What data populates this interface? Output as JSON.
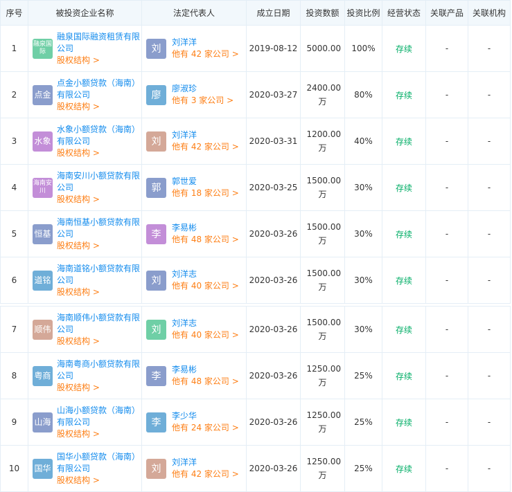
{
  "headers": [
    "序号",
    "被投资企业名称",
    "法定代表人",
    "成立日期",
    "投资数额",
    "投资比例",
    "经营状态",
    "关联产品",
    "关联机构"
  ],
  "equity_label": "股权结构 >",
  "rows": [
    {
      "no": "1",
      "logo": "融泉国际",
      "logo_color": "#6fcfa6",
      "company": "融泉国际融资租赁有限公司",
      "avatar": "刘",
      "avatar_color": "#8a9dcc",
      "rep": "刘洋洋",
      "rep_count": "他有 42 家公司 >",
      "date": "2019-08-12",
      "amount": "5000.00",
      "ratio": "100%",
      "status": "存续",
      "products": "-",
      "orgs": "-"
    },
    {
      "no": "2",
      "logo": "点金",
      "logo_color": "#8a9dcc",
      "company": "点金小额贷款（海南）有限公司",
      "avatar": "廖",
      "avatar_color": "#6faed8",
      "rep": "廖淑珍",
      "rep_count": "他有 3 家公司 >",
      "date": "2020-03-27",
      "amount": "2400.00万",
      "ratio": "80%",
      "status": "存续",
      "products": "-",
      "orgs": "-"
    },
    {
      "no": "3",
      "logo": "水象",
      "logo_color": "#c38ed8",
      "company": "水象小额贷款（海南）有限公司",
      "avatar": "刘",
      "avatar_color": "#d4a898",
      "rep": "刘洋洋",
      "rep_count": "他有 42 家公司 >",
      "date": "2020-03-31",
      "amount": "1200.00万",
      "ratio": "40%",
      "status": "存续",
      "products": "-",
      "orgs": "-"
    },
    {
      "no": "4",
      "logo": "海南安川",
      "logo_color": "#c38ed8",
      "company": "海南安川小额贷款有限公司",
      "avatar": "郭",
      "avatar_color": "#8a9dcc",
      "rep": "郭世爱",
      "rep_count": "他有 18 家公司 >",
      "date": "2020-03-25",
      "amount": "1500.00万",
      "ratio": "30%",
      "status": "存续",
      "products": "-",
      "orgs": "-"
    },
    {
      "no": "5",
      "logo": "恒基",
      "logo_color": "#8a9dcc",
      "company": "海南恒基小额贷款有限公司",
      "avatar": "李",
      "avatar_color": "#c38ed8",
      "rep": "李易彬",
      "rep_count": "他有 48 家公司 >",
      "date": "2020-03-26",
      "amount": "1500.00万",
      "ratio": "30%",
      "status": "存续",
      "products": "-",
      "orgs": "-"
    },
    {
      "no": "6",
      "logo": "道铭",
      "logo_color": "#6faed8",
      "company": "海南道铭小额贷款有限公司",
      "avatar": "刘",
      "avatar_color": "#8a9dcc",
      "rep": "刘洋志",
      "rep_count": "他有 40 家公司 >",
      "date": "2020-03-26",
      "amount": "1500.00万",
      "ratio": "30%",
      "status": "存续",
      "products": "-",
      "orgs": "-"
    },
    {
      "no": "7",
      "logo": "顺伟",
      "logo_color": "#d4a898",
      "company": "海南顺伟小额贷款有限公司",
      "avatar": "刘",
      "avatar_color": "#6fcfa6",
      "rep": "刘洋志",
      "rep_count": "他有 40 家公司 >",
      "date": "2020-03-26",
      "amount": "1500.00万",
      "ratio": "30%",
      "status": "存续",
      "products": "-",
      "orgs": "-"
    },
    {
      "no": "8",
      "logo": "粤商",
      "logo_color": "#6faed8",
      "company": "海南粤商小额贷款有限公司",
      "avatar": "李",
      "avatar_color": "#8a9dcc",
      "rep": "李易彬",
      "rep_count": "他有 48 家公司 >",
      "date": "2020-03-26",
      "amount": "1250.00万",
      "ratio": "25%",
      "status": "存续",
      "products": "-",
      "orgs": "-"
    },
    {
      "no": "9",
      "logo": "山海",
      "logo_color": "#8a9dcc",
      "company": "山海小额贷款（海南）有限公司",
      "avatar": "李",
      "avatar_color": "#6faed8",
      "rep": "李少华",
      "rep_count": "他有 24 家公司 >",
      "date": "2020-03-26",
      "amount": "1250.00万",
      "ratio": "25%",
      "status": "存续",
      "products": "-",
      "orgs": "-"
    },
    {
      "no": "10",
      "logo": "国华",
      "logo_color": "#6faed8",
      "company": "国华小额贷款（海南）有限公司",
      "avatar": "刘",
      "avatar_color": "#d4a898",
      "rep": "刘洋洋",
      "rep_count": "他有 42 家公司 >",
      "date": "2020-03-26",
      "amount": "1250.00万",
      "ratio": "25%",
      "status": "存续",
      "products": "-",
      "orgs": "-"
    }
  ]
}
